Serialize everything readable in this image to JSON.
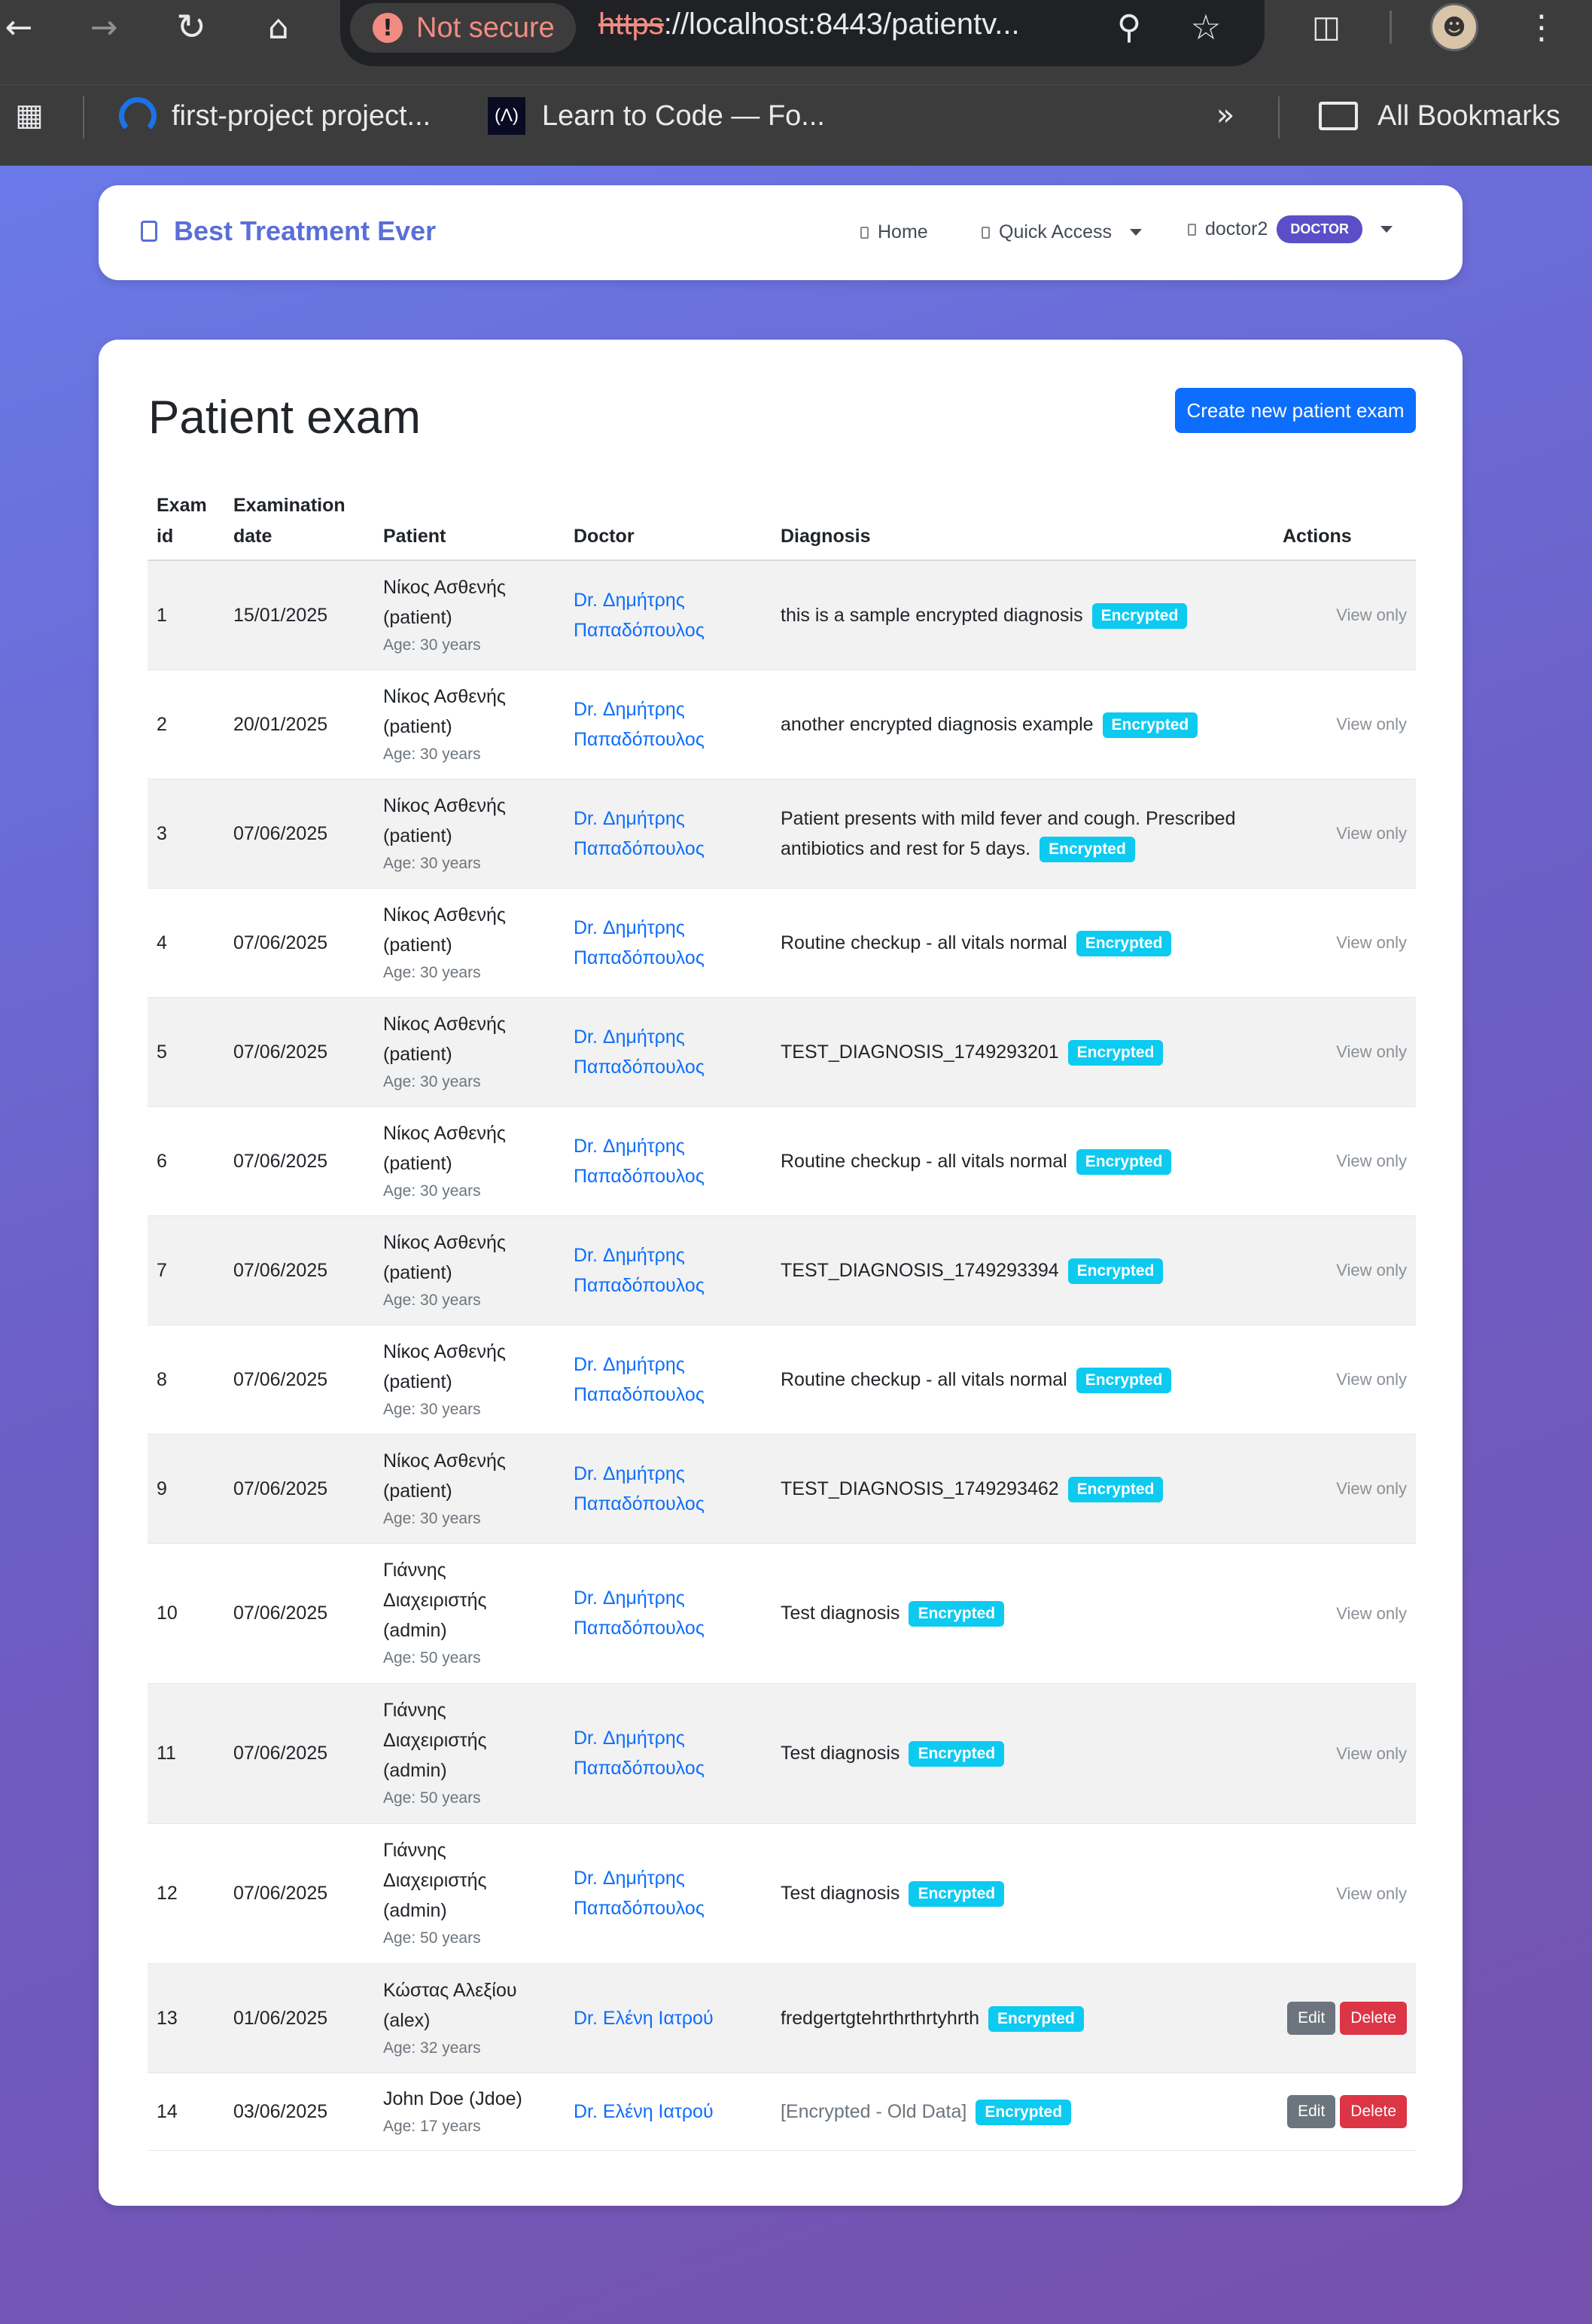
{
  "browser": {
    "security_label": "Not secure",
    "url_proto": "https",
    "url_rest": "://localhost:8443/patientv...",
    "bookmarks": [
      {
        "label": "first-project project..."
      },
      {
        "label": "Learn to Code — Fo..."
      }
    ],
    "all_bookmarks_label": "All Bookmarks"
  },
  "navbar": {
    "brand": "Best Treatment Ever",
    "home_label": "Home",
    "quick_access_label": "Quick Access",
    "user_label": "doctor2",
    "role_badge": "DOCTOR"
  },
  "main": {
    "title": "Patient exam",
    "create_button": "Create new patient exam",
    "columns": {
      "exam_id_line1": "Exam",
      "exam_id_line2": "id",
      "date_line1": "Examination",
      "date_line2": "date",
      "patient": "Patient",
      "doctor": "Doctor",
      "diagnosis": "Diagnosis",
      "actions": "Actions"
    },
    "badge_label": "Encrypted",
    "view_only_label": "View only",
    "edit_label": "Edit",
    "delete_label": "Delete",
    "rows": [
      {
        "id": "1",
        "date": "15/01/2025",
        "patient_lines": [
          "Νίκος Ασθενής",
          "(patient)"
        ],
        "age": "Age: 30 years",
        "doctor_lines": [
          "Dr. Δημήτρης",
          "Παπαδόπουλος"
        ],
        "diagnosis": "this is a sample encrypted diagnosis",
        "action": "view"
      },
      {
        "id": "2",
        "date": "20/01/2025",
        "patient_lines": [
          "Νίκος Ασθενής",
          "(patient)"
        ],
        "age": "Age: 30 years",
        "doctor_lines": [
          "Dr. Δημήτρης",
          "Παπαδόπουλος"
        ],
        "diagnosis": "another encrypted diagnosis example",
        "action": "view"
      },
      {
        "id": "3",
        "date": "07/06/2025",
        "patient_lines": [
          "Νίκος Ασθενής",
          "(patient)"
        ],
        "age": "Age: 30 years",
        "doctor_lines": [
          "Dr. Δημήτρης",
          "Παπαδόπουλος"
        ],
        "diagnosis": "Patient presents with mild fever and cough. Prescribed antibiotics and rest for 5 days.",
        "action": "view"
      },
      {
        "id": "4",
        "date": "07/06/2025",
        "patient_lines": [
          "Νίκος Ασθενής",
          "(patient)"
        ],
        "age": "Age: 30 years",
        "doctor_lines": [
          "Dr. Δημήτρης",
          "Παπαδόπουλος"
        ],
        "diagnosis": "Routine checkup - all vitals normal",
        "action": "view"
      },
      {
        "id": "5",
        "date": "07/06/2025",
        "patient_lines": [
          "Νίκος Ασθενής",
          "(patient)"
        ],
        "age": "Age: 30 years",
        "doctor_lines": [
          "Dr. Δημήτρης",
          "Παπαδόπουλος"
        ],
        "diagnosis": "TEST_DIAGNOSIS_1749293201",
        "action": "view"
      },
      {
        "id": "6",
        "date": "07/06/2025",
        "patient_lines": [
          "Νίκος Ασθενής",
          "(patient)"
        ],
        "age": "Age: 30 years",
        "doctor_lines": [
          "Dr. Δημήτρης",
          "Παπαδόπουλος"
        ],
        "diagnosis": "Routine checkup - all vitals normal",
        "action": "view"
      },
      {
        "id": "7",
        "date": "07/06/2025",
        "patient_lines": [
          "Νίκος Ασθενής",
          "(patient)"
        ],
        "age": "Age: 30 years",
        "doctor_lines": [
          "Dr. Δημήτρης",
          "Παπαδόπουλος"
        ],
        "diagnosis": "TEST_DIAGNOSIS_1749293394",
        "action": "view"
      },
      {
        "id": "8",
        "date": "07/06/2025",
        "patient_lines": [
          "Νίκος Ασθενής",
          "(patient)"
        ],
        "age": "Age: 30 years",
        "doctor_lines": [
          "Dr. Δημήτρης",
          "Παπαδόπουλος"
        ],
        "diagnosis": "Routine checkup - all vitals normal",
        "action": "view"
      },
      {
        "id": "9",
        "date": "07/06/2025",
        "patient_lines": [
          "Νίκος Ασθενής",
          "(patient)"
        ],
        "age": "Age: 30 years",
        "doctor_lines": [
          "Dr. Δημήτρης",
          "Παπαδόπουλος"
        ],
        "diagnosis": "TEST_DIAGNOSIS_1749293462",
        "action": "view"
      },
      {
        "id": "10",
        "date": "07/06/2025",
        "patient_lines": [
          "Γιάννης",
          "Διαχειριστής",
          "(admin)"
        ],
        "age": "Age: 50 years",
        "doctor_lines": [
          "Dr. Δημήτρης",
          "Παπαδόπουλος"
        ],
        "diagnosis": "Test diagnosis",
        "action": "view"
      },
      {
        "id": "11",
        "date": "07/06/2025",
        "patient_lines": [
          "Γιάννης",
          "Διαχειριστής",
          "(admin)"
        ],
        "age": "Age: 50 years",
        "doctor_lines": [
          "Dr. Δημήτρης",
          "Παπαδόπουλος"
        ],
        "diagnosis": "Test diagnosis",
        "action": "view"
      },
      {
        "id": "12",
        "date": "07/06/2025",
        "patient_lines": [
          "Γιάννης",
          "Διαχειριστής",
          "(admin)"
        ],
        "age": "Age: 50 years",
        "doctor_lines": [
          "Dr. Δημήτρης",
          "Παπαδόπουλος"
        ],
        "diagnosis": "Test diagnosis",
        "action": "view"
      },
      {
        "id": "13",
        "date": "01/06/2025",
        "patient_lines": [
          "Κώστας Αλεξίου",
          "(alex)"
        ],
        "age": "Age: 32 years",
        "doctor_lines": [
          "Dr. Ελένη Ιατρού"
        ],
        "diagnosis": "fredgertgtehrthrthrtyhrth",
        "action": "edit"
      },
      {
        "id": "14",
        "date": "03/06/2025",
        "patient_lines": [
          "John Doe (Jdoe)"
        ],
        "age": "Age: 17 years",
        "doctor_lines": [
          "Dr. Ελένη Ιατρού"
        ],
        "diagnosis": "[Encrypted - Old Data]",
        "diagnosis_muted": true,
        "action": "edit"
      }
    ]
  }
}
